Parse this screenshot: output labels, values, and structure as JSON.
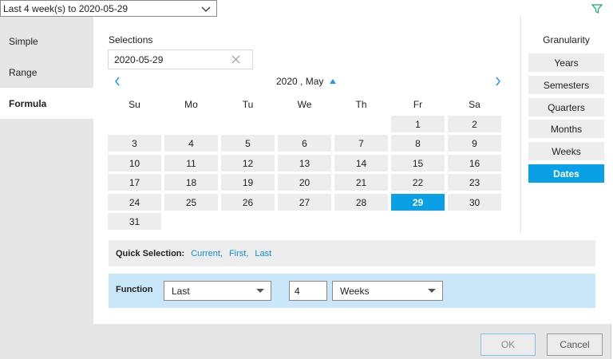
{
  "top_select": {
    "value": "Last 4 week(s) to 2020-05-29"
  },
  "tabs": [
    {
      "label": "Simple",
      "active": false
    },
    {
      "label": "Range",
      "active": false
    },
    {
      "label": "Formula",
      "active": true
    }
  ],
  "selections": {
    "label": "Selections",
    "date_value": "2020-05-29"
  },
  "calendar": {
    "month_label": "2020 , May",
    "weekdays": [
      "Su",
      "Mo",
      "Tu",
      "We",
      "Th",
      "Fr",
      "Sa"
    ],
    "first_weekday_index": 5,
    "days": [
      "1",
      "2",
      "3",
      "4",
      "5",
      "6",
      "7",
      "8",
      "9",
      "10",
      "11",
      "12",
      "13",
      "14",
      "15",
      "16",
      "17",
      "18",
      "19",
      "20",
      "21",
      "22",
      "23",
      "24",
      "25",
      "26",
      "27",
      "28",
      "29",
      "30",
      "31"
    ],
    "selected_day": "29"
  },
  "granularity": {
    "title": "Granularity",
    "options": [
      "Years",
      "Semesters",
      "Quarters",
      "Months",
      "Weeks",
      "Dates"
    ],
    "active": "Dates"
  },
  "quick_selection": {
    "label": "Quick Selection:",
    "links": [
      "Current,",
      "First,",
      "Last"
    ]
  },
  "function": {
    "label": "Function",
    "mode": "Last",
    "count": "4",
    "unit": "Weeks"
  },
  "buttons": {
    "ok": "OK",
    "cancel": "Cancel"
  },
  "colors": {
    "accent": "#0aa0e6",
    "function_bg": "#c9e7f9",
    "link": "#0a8fd8"
  }
}
